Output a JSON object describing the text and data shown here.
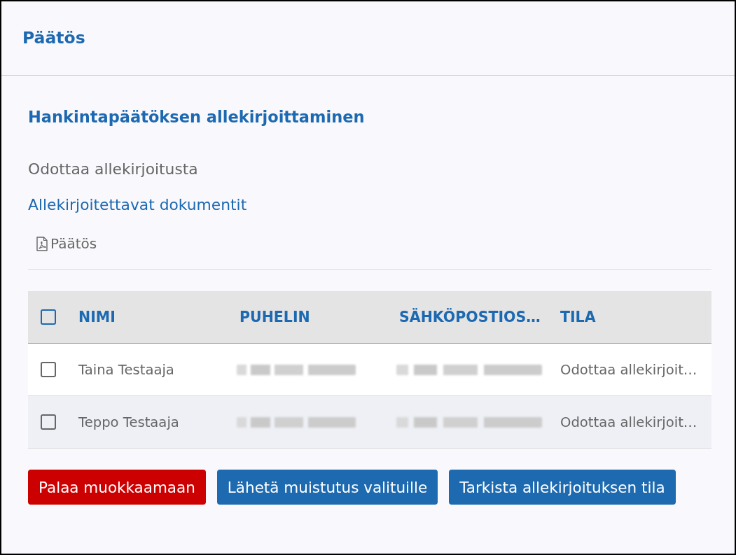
{
  "panel": {
    "title": "Päätös"
  },
  "section": {
    "title": "Hankintapäätöksen allekirjoittaminen",
    "status": "Odottaa allekirjoitusta",
    "documents_heading": "Allekirjoitettavat dokumentit",
    "documents": [
      {
        "name": "Päätös",
        "kind": "pdf"
      }
    ]
  },
  "table": {
    "select_all": {
      "checked": false
    },
    "columns": [
      {
        "label": "NIMI",
        "kind": "name"
      },
      {
        "label": "PUHELIN",
        "kind": "blurred"
      },
      {
        "label": "SÄHKÖPOSTIOS…",
        "kind": "blurred"
      },
      {
        "label": "TILA",
        "kind": "status"
      }
    ],
    "rows": [
      {
        "selected": false,
        "name": "Taina Testaaja",
        "status": "Odottaa allekirjoit…"
      },
      {
        "selected": false,
        "name": "Teppo Testaaja",
        "status": "Odottaa allekirjoit…"
      }
    ]
  },
  "buttons": [
    {
      "label": "Palaa muokkaamaan",
      "kind": "danger"
    },
    {
      "label": "Lähetä muistutus valituille",
      "kind": "primary"
    },
    {
      "label": "Tarkista allekirjoituksen tila",
      "kind": "primary"
    }
  ]
}
